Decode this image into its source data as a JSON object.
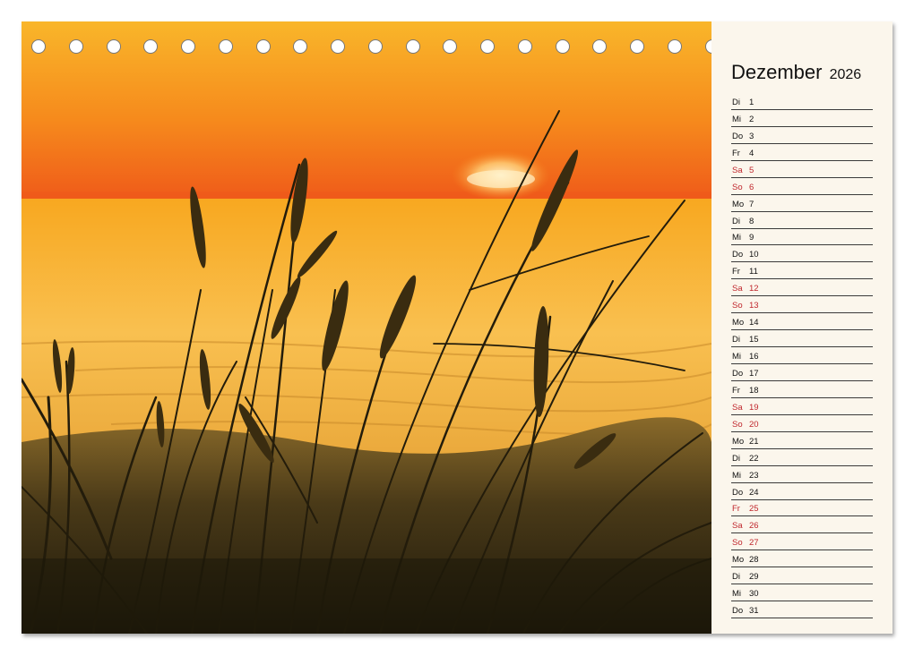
{
  "calendar": {
    "month": "Dezember",
    "year": "2026",
    "days": [
      {
        "wd": "Di",
        "num": "1",
        "red": false
      },
      {
        "wd": "Mi",
        "num": "2",
        "red": false
      },
      {
        "wd": "Do",
        "num": "3",
        "red": false
      },
      {
        "wd": "Fr",
        "num": "4",
        "red": false
      },
      {
        "wd": "Sa",
        "num": "5",
        "red": true
      },
      {
        "wd": "So",
        "num": "6",
        "red": true
      },
      {
        "wd": "Mo",
        "num": "7",
        "red": false
      },
      {
        "wd": "Di",
        "num": "8",
        "red": false
      },
      {
        "wd": "Mi",
        "num": "9",
        "red": false
      },
      {
        "wd": "Do",
        "num": "10",
        "red": false
      },
      {
        "wd": "Fr",
        "num": "11",
        "red": false
      },
      {
        "wd": "Sa",
        "num": "12",
        "red": true
      },
      {
        "wd": "So",
        "num": "13",
        "red": true
      },
      {
        "wd": "Mo",
        "num": "14",
        "red": false
      },
      {
        "wd": "Di",
        "num": "15",
        "red": false
      },
      {
        "wd": "Mi",
        "num": "16",
        "red": false
      },
      {
        "wd": "Do",
        "num": "17",
        "red": false
      },
      {
        "wd": "Fr",
        "num": "18",
        "red": false
      },
      {
        "wd": "Sa",
        "num": "19",
        "red": true
      },
      {
        "wd": "So",
        "num": "20",
        "red": true
      },
      {
        "wd": "Mo",
        "num": "21",
        "red": false
      },
      {
        "wd": "Di",
        "num": "22",
        "red": false
      },
      {
        "wd": "Mi",
        "num": "23",
        "red": false
      },
      {
        "wd": "Do",
        "num": "24",
        "red": false
      },
      {
        "wd": "Fr",
        "num": "25",
        "red": true
      },
      {
        "wd": "Sa",
        "num": "26",
        "red": true
      },
      {
        "wd": "So",
        "num": "27",
        "red": true
      },
      {
        "wd": "Mo",
        "num": "28",
        "red": false
      },
      {
        "wd": "Di",
        "num": "29",
        "red": false
      },
      {
        "wd": "Mi",
        "num": "30",
        "red": false
      },
      {
        "wd": "Do",
        "num": "31",
        "red": false
      }
    ]
  },
  "colors": {
    "holiday": "#c0272d",
    "sky_top": "#f5a623",
    "horizon": "#f26a1b",
    "sea": "#f7b733",
    "grass": "#2b2410"
  },
  "photo": {
    "subject": "beach-grass-sunset"
  },
  "binding_hole_count": 23
}
